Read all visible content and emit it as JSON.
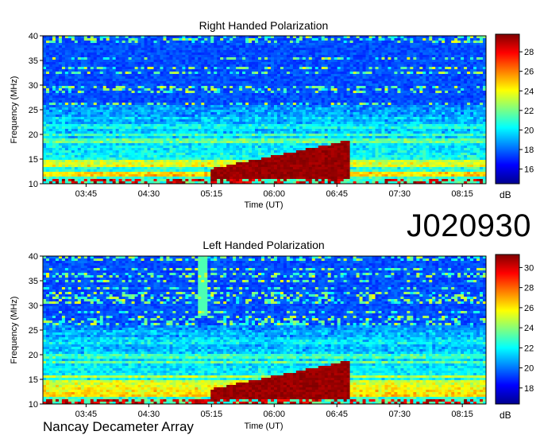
{
  "figure": {
    "code": "J020930",
    "footer": "Nancay Decameter Array"
  },
  "chart_data": [
    {
      "type": "heatmap",
      "title": "Right Handed Polarization",
      "xlabel": "Time (UT)",
      "ylabel": "Frequency (MHz)",
      "x_range": [
        "03:14",
        "08:32"
      ],
      "ylim": [
        10,
        40
      ],
      "x_ticks": [
        "03:45",
        "04:30",
        "05:15",
        "06:00",
        "06:45",
        "07:30",
        "08:15"
      ],
      "y_ticks": [
        10,
        15,
        20,
        25,
        30,
        35,
        40
      ],
      "colorbar": {
        "label": "dB",
        "ticks": [
          16,
          18,
          20,
          22,
          24,
          26,
          28
        ],
        "range": [
          14.5,
          29.8
        ]
      },
      "colormap": "jet",
      "burst_end_time": "06:55"
    },
    {
      "type": "heatmap",
      "title": "Left Handed Polarization",
      "xlabel": "Time (UT)",
      "ylabel": "Frequency (MHz)",
      "x_range": [
        "03:14",
        "08:32"
      ],
      "ylim": [
        10,
        40
      ],
      "x_ticks": [
        "03:45",
        "04:30",
        "05:15",
        "06:00",
        "06:45",
        "07:30",
        "08:15"
      ],
      "y_ticks": [
        10,
        15,
        20,
        25,
        30,
        35,
        40
      ],
      "colorbar": {
        "label": "dB",
        "ticks": [
          18,
          20,
          22,
          24,
          26,
          28,
          30
        ],
        "range": [
          16.4,
          31.3
        ]
      },
      "colormap": "jet",
      "burst_end_time": "06:55"
    }
  ]
}
